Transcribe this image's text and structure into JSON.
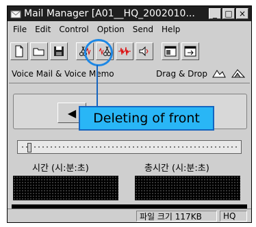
{
  "window": {
    "title": "Mail Manager [A01__HQ_2002010...",
    "controls": {
      "minimize": "_",
      "maximize": "□",
      "close": "×"
    }
  },
  "menu": [
    "File",
    "Edit",
    "Control",
    "Option",
    "Send",
    "Help"
  ],
  "toolbar": [
    {
      "icon": "new-file-icon"
    },
    {
      "icon": "open-folder-icon"
    },
    {
      "icon": "save-disk-icon"
    },
    {
      "icon": "cut-front-icon"
    },
    {
      "icon": "cut-back-icon"
    },
    {
      "icon": "split-wave-icon"
    },
    {
      "icon": "speaker-icon"
    },
    {
      "icon": "window-icon"
    },
    {
      "icon": "window-arrow-icon"
    }
  ],
  "memo_row": {
    "left": "Voice Mail & Voice Memo",
    "right": "Drag & Drop"
  },
  "tooltip": "Deleting of front",
  "time": {
    "elapsed_label": "시간 (시:분:초)",
    "total_label": "총시간 (시:분:초)"
  },
  "status": {
    "file_size": "파일 크기 117KB",
    "quality": "HQ"
  },
  "clipped_text": [
    "h",
    "f",
    "d",
    ",",
    "t"
  ],
  "colors": {
    "tooltip_bg": "#29b6f6",
    "highlight": "#1e88e5"
  }
}
